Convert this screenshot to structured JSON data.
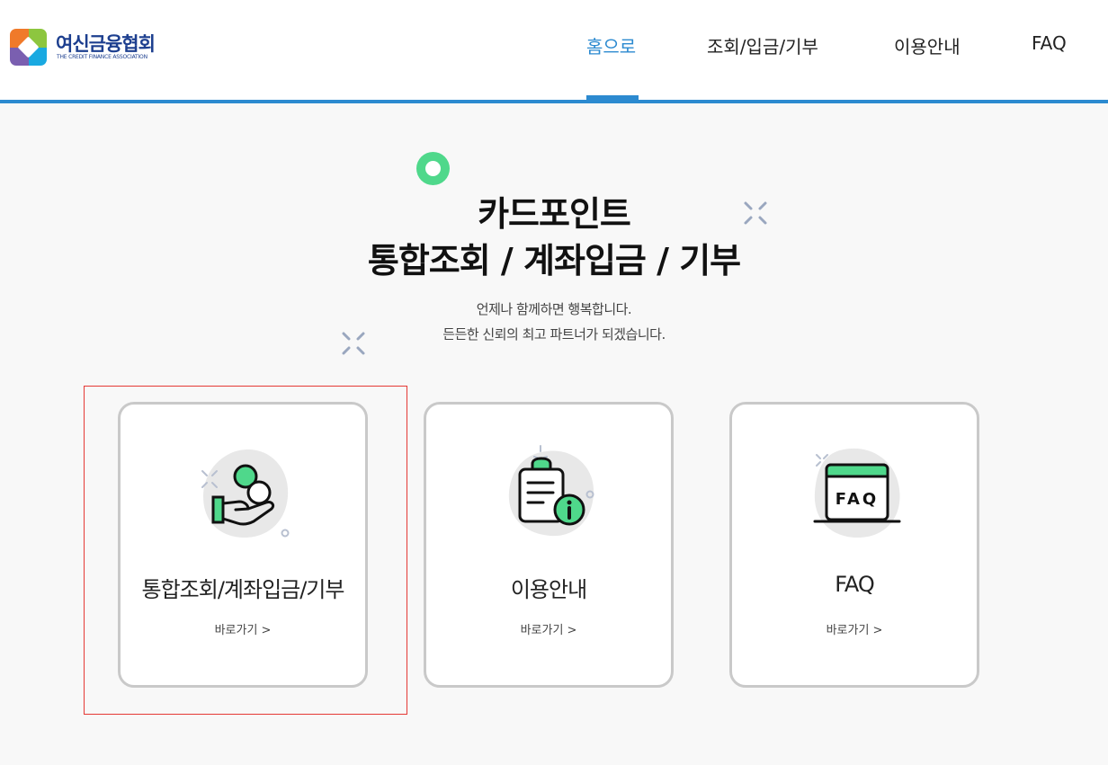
{
  "header": {
    "logo_name": "여신금융협회",
    "logo_sub": "THE CREDIT FINANCE ASSOCIATION",
    "nav": [
      {
        "label": "홈으로",
        "active": true
      },
      {
        "label": "조회/입금/기부",
        "active": false
      },
      {
        "label": "이용안내",
        "active": false
      },
      {
        "label": "FAQ",
        "active": false
      }
    ]
  },
  "hero": {
    "title_line1": "카드포인트",
    "title_line2": "통합조회 / 계좌입금 / 기부",
    "sub_line1": "언제나 함께하면 행복합니다.",
    "sub_line2": "든든한 신뢰의 최고 파트너가 되겠습니다."
  },
  "cards": [
    {
      "title": "통합조회/계좌입금/기부",
      "link": "바로가기 >",
      "icon": "coin-hand-icon"
    },
    {
      "title": "이용안내",
      "link": "바로가기 >",
      "icon": "clipboard-info-icon"
    },
    {
      "title": "FAQ",
      "link": "바로가기 >",
      "icon": "faq-board-icon"
    }
  ],
  "colors": {
    "accent": "#2c8ad0",
    "green": "#4fd88b",
    "highlight": "#e53935"
  }
}
